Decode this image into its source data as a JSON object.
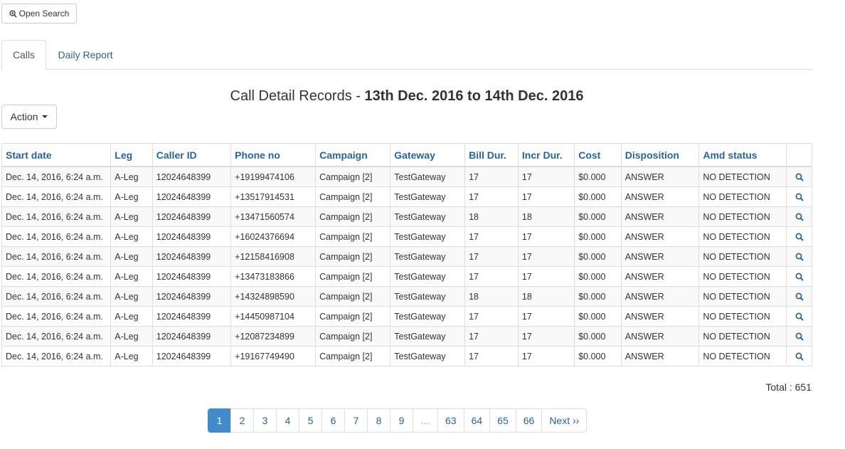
{
  "toolbar": {
    "open_search_label": "Open Search"
  },
  "tabs": [
    {
      "label": "Calls",
      "active": true
    },
    {
      "label": "Daily Report",
      "active": false
    }
  ],
  "title": {
    "prefix": "Call Detail Records - ",
    "range": "13th Dec. 2016 to 14th Dec. 2016"
  },
  "action": {
    "label": "Action"
  },
  "table": {
    "columns": [
      "Start date",
      "Leg",
      "Caller ID",
      "Phone no",
      "Campaign",
      "Gateway",
      "Bill Dur.",
      "Incr Dur.",
      "Cost",
      "Disposition",
      "Amd status"
    ],
    "rows": [
      [
        "Dec. 14, 2016, 6:24 a.m.",
        "A-Leg",
        "12024648399",
        "+19199474106",
        "Campaign [2]",
        "TestGateway",
        "17",
        "17",
        "$0.000",
        "ANSWER",
        "NO DETECTION"
      ],
      [
        "Dec. 14, 2016, 6:24 a.m.",
        "A-Leg",
        "12024648399",
        "+13517914531",
        "Campaign [2]",
        "TestGateway",
        "17",
        "17",
        "$0.000",
        "ANSWER",
        "NO DETECTION"
      ],
      [
        "Dec. 14, 2016, 6:24 a.m.",
        "A-Leg",
        "12024648399",
        "+13471560574",
        "Campaign [2]",
        "TestGateway",
        "18",
        "18",
        "$0.000",
        "ANSWER",
        "NO DETECTION"
      ],
      [
        "Dec. 14, 2016, 6:24 a.m.",
        "A-Leg",
        "12024648399",
        "+16024376694",
        "Campaign [2]",
        "TestGateway",
        "17",
        "17",
        "$0.000",
        "ANSWER",
        "NO DETECTION"
      ],
      [
        "Dec. 14, 2016, 6:24 a.m.",
        "A-Leg",
        "12024648399",
        "+12158416908",
        "Campaign [2]",
        "TestGateway",
        "17",
        "17",
        "$0.000",
        "ANSWER",
        "NO DETECTION"
      ],
      [
        "Dec. 14, 2016, 6:24 a.m.",
        "A-Leg",
        "12024648399",
        "+13473183866",
        "Campaign [2]",
        "TestGateway",
        "17",
        "17",
        "$0.000",
        "ANSWER",
        "NO DETECTION"
      ],
      [
        "Dec. 14, 2016, 6:24 a.m.",
        "A-Leg",
        "12024648399",
        "+14324898590",
        "Campaign [2]",
        "TestGateway",
        "18",
        "18",
        "$0.000",
        "ANSWER",
        "NO DETECTION"
      ],
      [
        "Dec. 14, 2016, 6:24 a.m.",
        "A-Leg",
        "12024648399",
        "+14450987104",
        "Campaign [2]",
        "TestGateway",
        "17",
        "17",
        "$0.000",
        "ANSWER",
        "NO DETECTION"
      ],
      [
        "Dec. 14, 2016, 6:24 a.m.",
        "A-Leg",
        "12024648399",
        "+12087234899",
        "Campaign [2]",
        "TestGateway",
        "17",
        "17",
        "$0.000",
        "ANSWER",
        "NO DETECTION"
      ],
      [
        "Dec. 14, 2016, 6:24 a.m.",
        "A-Leg",
        "12024648399",
        "+19167749490",
        "Campaign [2]",
        "TestGateway",
        "17",
        "17",
        "$0.000",
        "ANSWER",
        "NO DETECTION"
      ]
    ],
    "row_action_icon": "search-icon"
  },
  "total_label": "Total : 651",
  "pagination": {
    "pages": [
      "1",
      "2",
      "3",
      "4",
      "5",
      "6",
      "7",
      "8",
      "9",
      "…",
      "63",
      "64",
      "65",
      "66"
    ],
    "active": "1",
    "next_label": "Next ››"
  },
  "colors": {
    "link": "#2a6496",
    "active_page": "#428bca"
  }
}
